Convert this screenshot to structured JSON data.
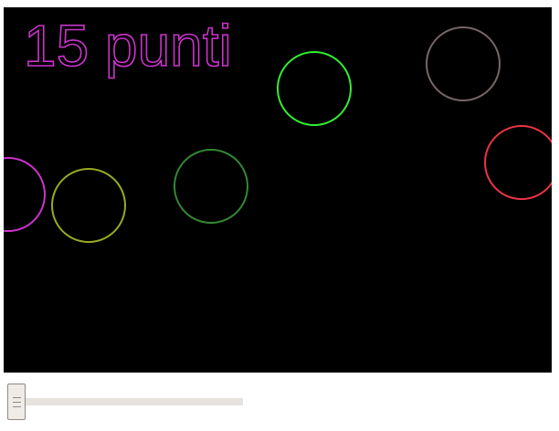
{
  "game": {
    "background": "#000000",
    "score_text": "15 punti",
    "score_color": "#cc33cc",
    "circles": [
      {
        "color": "#cc33cc"
      },
      {
        "color": "#99aa22"
      },
      {
        "color": "#338833"
      },
      {
        "color": "#33ee33"
      },
      {
        "color": "#776666"
      },
      {
        "color": "#ee3344"
      }
    ]
  },
  "slider": {
    "value": 0.0,
    "track_color": "#e6e3de",
    "thumb_color": "#efebe7"
  }
}
